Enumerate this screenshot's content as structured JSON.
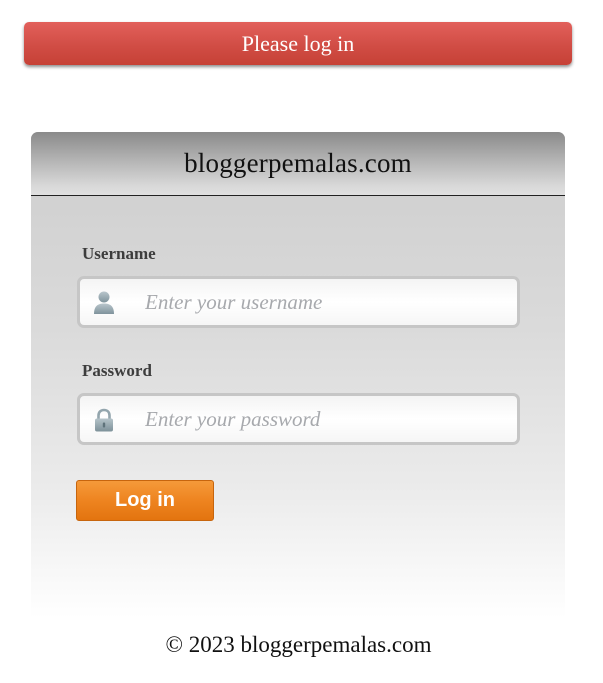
{
  "banner": {
    "message": "Please log in",
    "color": "#d14d45"
  },
  "card": {
    "site_title": "bloggerpemalas.com"
  },
  "form": {
    "username_label": "Username",
    "username_placeholder": "Enter your username",
    "username_value": "",
    "username_icon": "user-icon",
    "password_label": "Password",
    "password_placeholder": "Enter your password",
    "password_value": "",
    "password_icon": "lock-icon",
    "submit_label": "Log in",
    "submit_color": "#ee8420"
  },
  "footer": {
    "text": "© 2023 bloggerpemalas.com"
  }
}
